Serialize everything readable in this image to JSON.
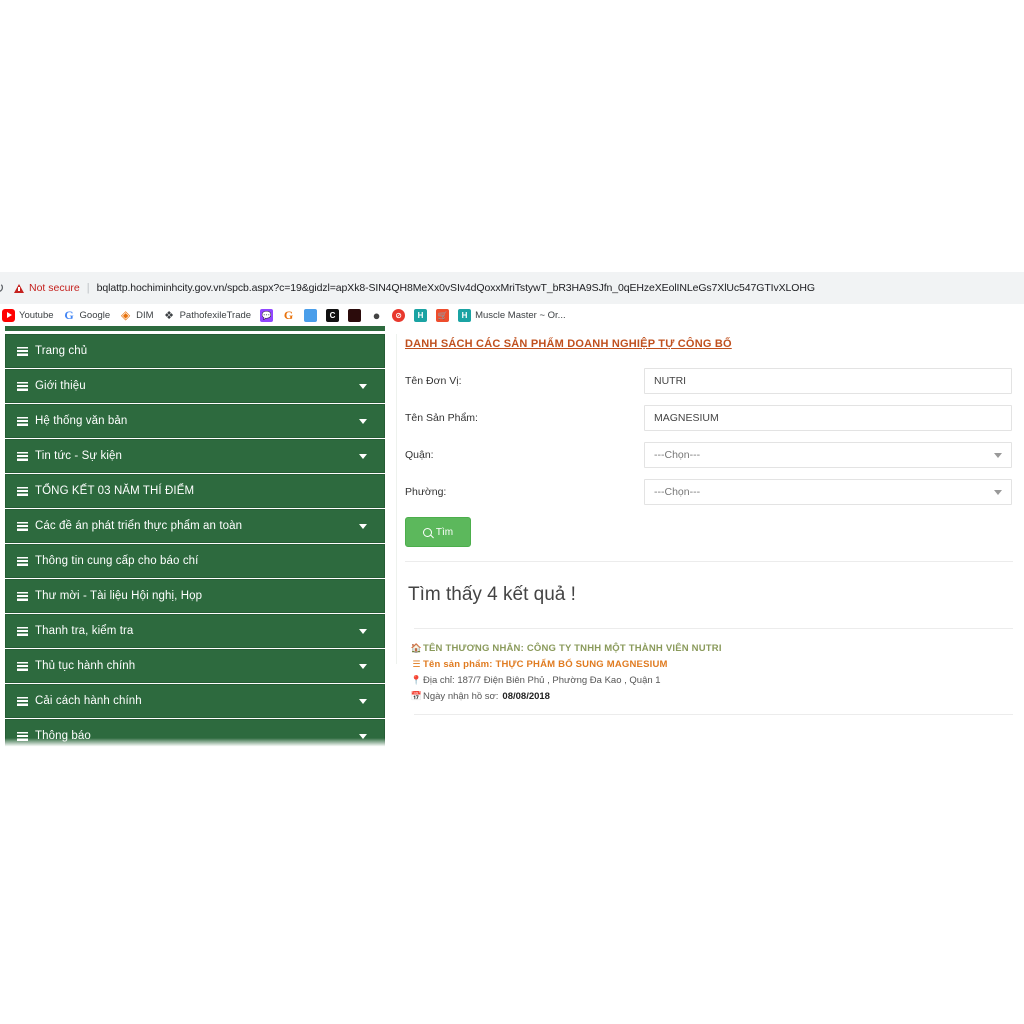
{
  "browser": {
    "reload_icon": "reload-icon",
    "security_label": "Not secure",
    "security_icon": "warning-triangle-icon",
    "url": "bqlattp.hochiminhcity.gov.vn/spcb.aspx?c=19&gidzl=apXk8-SIN4QH8MeXx0vSIv4dQoxxMriTstywT_bR3HA9SJfn_0qEHzeXEolINLeGs7XlUc547GTIvXLOHG",
    "bookmarks": [
      {
        "label": "Youtube",
        "icon": "youtube-icon"
      },
      {
        "label": "Google",
        "icon": "google-icon"
      },
      {
        "label": "DIM",
        "icon": "dim-icon"
      },
      {
        "label": "PathofexileTrade",
        "icon": "pathofexile-icon"
      },
      {
        "label": "",
        "icon": "twitch-icon"
      },
      {
        "label": "",
        "icon": "grammarly-icon"
      },
      {
        "label": "",
        "icon": "blue-app-icon"
      },
      {
        "label": "",
        "icon": "crescent-icon"
      },
      {
        "label": "",
        "icon": "dark-square-icon"
      },
      {
        "label": "",
        "icon": "sphere-icon"
      },
      {
        "label": "",
        "icon": "block-icon"
      },
      {
        "label": "",
        "icon": "h-teal-icon"
      },
      {
        "label": "",
        "icon": "shopee-icon"
      },
      {
        "label": "Muscle Master ~ Or...",
        "icon": "h-teal-icon"
      }
    ]
  },
  "sidebar": {
    "items": [
      {
        "label": "Trang chủ",
        "has_caret": false
      },
      {
        "label": "Giới thiệu",
        "has_caret": true
      },
      {
        "label": "Hệ thống văn bản",
        "has_caret": true
      },
      {
        "label": "Tin tức - Sự kiện",
        "has_caret": true
      },
      {
        "label": "TỔNG KẾT 03 NĂM THÍ ĐIỂM",
        "has_caret": false
      },
      {
        "label": "Các đề án phát triển thực phẩm an toàn",
        "has_caret": true
      },
      {
        "label": "Thông tin cung cấp cho báo chí",
        "has_caret": false
      },
      {
        "label": "Thư mời - Tài liệu Hội nghị, Họp",
        "has_caret": false
      },
      {
        "label": "Thanh tra, kiểm tra",
        "has_caret": true
      },
      {
        "label": "Thủ tục hành chính",
        "has_caret": true
      },
      {
        "label": "Cải cách hành chính",
        "has_caret": true
      },
      {
        "label": "Thông báo",
        "has_caret": true
      }
    ]
  },
  "content": {
    "title": "DANH SÁCH CÁC SẢN PHẨM DOANH NGHIỆP TỰ CÔNG BỐ",
    "form": {
      "rows": [
        {
          "label": "Tên Đơn Vị:",
          "value": "NUTRI",
          "type": "text",
          "name": "don-vi"
        },
        {
          "label": "Tên Sản Phẩm:",
          "value": "MAGNESIUM",
          "type": "text",
          "name": "san-pham"
        },
        {
          "label": "Quận:",
          "value": "---Chọn---",
          "type": "select",
          "name": "quan"
        },
        {
          "label": "Phường:",
          "value": "---Chọn---",
          "type": "select",
          "name": "phuong"
        }
      ],
      "search_button": "Tìm",
      "search_icon": "search-icon"
    },
    "results_count": "Tìm thấy 4 kết quả !",
    "results": [
      {
        "merchant_icon": "home-icon",
        "merchant": "TÊN THƯƠNG NHÂN: CÔNG TY TNHH MỘT THÀNH VIÊN NUTRI",
        "product_icon": "list-icon",
        "product": "Tên sản phẩm: THỰC PHẨM BỔ SUNG MAGNESIUM",
        "address_icon": "location-pin-icon",
        "address": "Địa chỉ: 187/7 Điện Biên Phủ , Phường Đa Kao , Quận 1",
        "date_icon": "calendar-icon",
        "date_label": "Ngày nhận hồ sơ:",
        "date_value": "08/08/2018"
      }
    ]
  },
  "colors": {
    "sidebar_green": "#2d6a3e",
    "button_green": "#5cb85c",
    "title_orange": "#c0501e",
    "merchant_olive": "#8a9a5b",
    "product_orange": "#e07b20",
    "not_secure_red": "#c5221f"
  }
}
